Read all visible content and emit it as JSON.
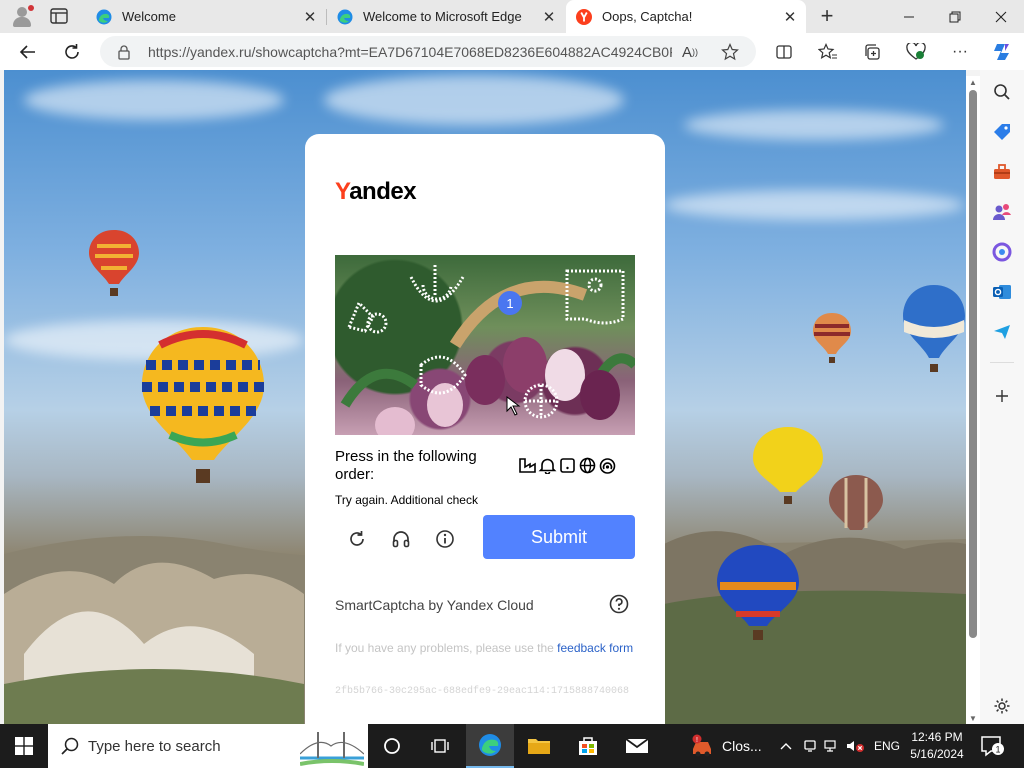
{
  "browser": {
    "tabs": [
      {
        "title": "Welcome",
        "active": false
      },
      {
        "title": "Welcome to Microsoft Edge",
        "active": false
      },
      {
        "title": "Oops, Captcha!",
        "active": true
      }
    ],
    "url": "https://yandex.ru/showcaptcha?mt=EA7D67104E7068ED8236E604882AC4924CB0F..."
  },
  "captcha": {
    "logo_y": "Y",
    "logo_rest": "andex",
    "prompt": "Press in the following order:",
    "order_icons": [
      "factory-icon",
      "bell-icon",
      "tablet-icon",
      "globe-icon",
      "signal-icon"
    ],
    "marker_number": "1",
    "status": "Try again. Additional check",
    "submit_label": "Submit",
    "powered_by": "SmartCaptcha by Yandex Cloud",
    "feedback_prefix": "If you have any problems, please use the ",
    "feedback_link": "feedback form",
    "captcha_id": "2fb5b766-30c295ac-688edfe9-29eac114:1715888740068",
    "accent_color": "#5282ff"
  },
  "taskbar": {
    "search_placeholder": "Type here to search",
    "notification_app_label": "Clos...",
    "language": "ENG",
    "time": "12:46 PM",
    "date": "5/16/2024",
    "notification_count": "1"
  }
}
